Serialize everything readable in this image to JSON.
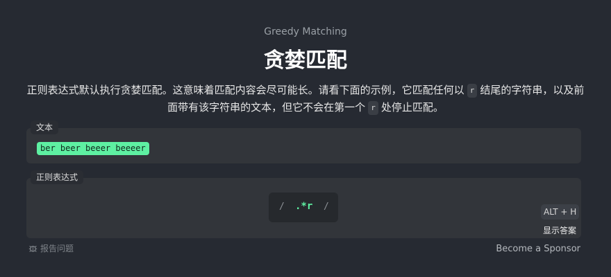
{
  "header": {
    "subtitle": "Greedy Matching",
    "title": "贪婪匹配"
  },
  "description": {
    "part1": "正则表达式默认执行贪婪匹配。这意味着匹配内容会尽可能长。请看下面的示例，它匹配任何以",
    "chip1": "r",
    "part2": "结尾的字符串，以及前面带有该字符串的文本，但它不会在第一个",
    "chip2": "r",
    "part3": "处停止匹配。"
  },
  "text_panel": {
    "label": "文本",
    "value": "ber beer beeer beeeer"
  },
  "regex_panel": {
    "label": "正则表达式",
    "slash_open": "/",
    "value": ".*r",
    "slash_close": "/",
    "shortcut": "ALT + H",
    "show_answer": "显示答案"
  },
  "footer": {
    "report_label": "报告问题",
    "report_icon": "bug-icon",
    "sponsor_link": "Become a Sponsor"
  },
  "colors": {
    "background": "#262a32",
    "panel": "#32353a",
    "match_highlight": "#5ef0a2"
  }
}
